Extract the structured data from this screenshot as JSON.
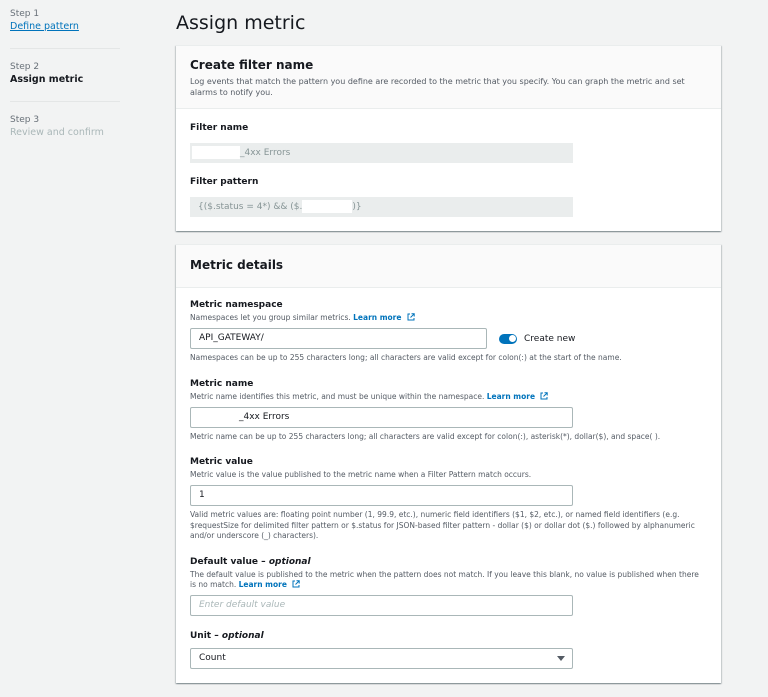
{
  "steps": [
    {
      "num": "Step 1",
      "title": "Define pattern"
    },
    {
      "num": "Step 2",
      "title": "Assign metric"
    },
    {
      "num": "Step 3",
      "title": "Review and confirm"
    }
  ],
  "page_title": "Assign metric",
  "filter_panel": {
    "title": "Create filter name",
    "description": "Log events that match the pattern you define are recorded to the metric that you specify. You can graph the metric and set alarms to notify you.",
    "filter_name_label": "Filter name",
    "filter_name_value": "_4xx Errors",
    "filter_pattern_label": "Filter pattern",
    "filter_pattern_prefix": "{($.status = 4*) && ($.",
    "filter_pattern_suffix": ")}"
  },
  "metric_panel": {
    "title": "Metric details",
    "namespace": {
      "label": "Metric namespace",
      "desc": "Namespaces let you group similar metrics.",
      "link": "Learn more",
      "value": "API_GATEWAY/",
      "toggle_label": "Create new",
      "toggle_on": true,
      "constraint": "Namespaces can be up to 255 characters long; all characters are valid except for colon(:) at the start of the name."
    },
    "name": {
      "label": "Metric name",
      "desc": "Metric name identifies this metric, and must be unique within the namespace.",
      "link": "Learn more",
      "value": "_4xx Errors",
      "constraint": "Metric name can be up to 255 characters long; all characters are valid except for colon(:), asterisk(*), dollar($), and space( )."
    },
    "value": {
      "label": "Metric value",
      "desc": "Metric value is the value published to the metric name when a Filter Pattern match occurs.",
      "value": "1",
      "constraint": "Valid metric values are: floating point number (1, 99.9, etc.), numeric field identifiers ($1, $2, etc.), or named field identifiers (e.g. $requestSize for delimited filter pattern or $.status for JSON-based filter pattern - dollar ($) or dollar dot ($.) followed by alphanumeric and/or underscore (_) characters)."
    },
    "default_value": {
      "label": "Default value",
      "optional": "optional",
      "desc": "The default value is published to the metric when the pattern does not match. If you leave this blank, no value is published when there is no match.",
      "link": "Learn more",
      "placeholder": "Enter default value"
    },
    "unit": {
      "label": "Unit",
      "optional": "optional",
      "selected": "Count"
    }
  },
  "colors": {
    "link": "#0073bb",
    "toggle": "#0073bb",
    "page_bg": "#f2f3f3"
  },
  "icons": [
    "external-link-icon",
    "caret-down-icon"
  ]
}
